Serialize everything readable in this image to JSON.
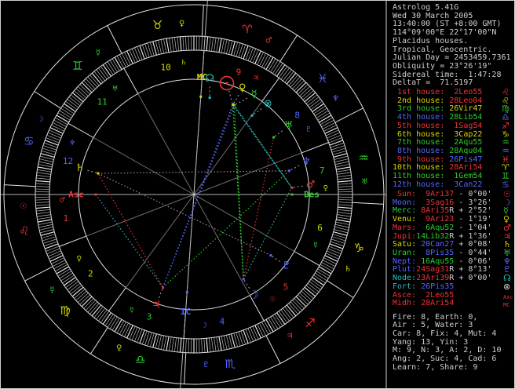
{
  "colors": {
    "red": "#ee3333",
    "yellow": "#d8d800",
    "green": "#2ecc2e",
    "blue": "#5566ff",
    "cyan": "#2abbbb",
    "white": "#cfcfcf",
    "gray": "#9a9a9a"
  },
  "header": {
    "lines": [
      "Astrolog 5.41G",
      "Wed 30 March 2005",
      "13:40:00 (ST +8:00 GMT)",
      "114°09'00\"E 22°17'00\"N",
      "Placidus houses.",
      "Tropical, Geocentric.",
      "Julian Day = 2453459.7361",
      "Obliquity = 23°26'19\"",
      "Sidereal time:  1:47:28",
      "DeltaT =  71.5197"
    ]
  },
  "houses": [
    {
      "label": " 1st house:",
      "label_color": "red",
      "value": "2Leo55",
      "value_color": "red",
      "glyph": "♌",
      "glyph_color": "red"
    },
    {
      "label": " 2nd house:",
      "label_color": "yellow",
      "value": "28Leo04",
      "value_color": "red",
      "glyph": "♌",
      "glyph_color": "yellow"
    },
    {
      "label": " 3rd house:",
      "label_color": "green",
      "value": "26Vir47",
      "value_color": "yellow",
      "glyph": "♍",
      "glyph_color": "green"
    },
    {
      "label": " 4th house:",
      "label_color": "blue",
      "value": "28Lib54",
      "value_color": "green",
      "glyph": "♎",
      "glyph_color": "blue"
    },
    {
      "label": " 5th house:",
      "label_color": "red",
      "value": "1Sag54",
      "value_color": "red",
      "glyph": "♐",
      "glyph_color": "red"
    },
    {
      "label": " 6th house:",
      "label_color": "yellow",
      "value": "3Cap22",
      "value_color": "yellow",
      "glyph": "♑",
      "glyph_color": "yellow"
    },
    {
      "label": " 7th house:",
      "label_color": "green",
      "value": "2Aqu55",
      "value_color": "green",
      "glyph": "♒",
      "glyph_color": "green"
    },
    {
      "label": " 8th house:",
      "label_color": "blue",
      "value": "28Aqu04",
      "value_color": "green",
      "glyph": "♒",
      "glyph_color": "blue"
    },
    {
      "label": " 9th house:",
      "label_color": "red",
      "value": "26Pis47",
      "value_color": "blue",
      "glyph": "♓",
      "glyph_color": "red"
    },
    {
      "label": "10th house:",
      "label_color": "yellow",
      "value": "28Ari54",
      "value_color": "red",
      "glyph": "♈",
      "glyph_color": "yellow"
    },
    {
      "label": "11th house:",
      "label_color": "green",
      "value": "1Gem54",
      "value_color": "green",
      "glyph": "♊",
      "glyph_color": "green"
    },
    {
      "label": "12th house:",
      "label_color": "blue",
      "value": "3Can22",
      "value_color": "blue",
      "glyph": "♋",
      "glyph_color": "blue"
    }
  ],
  "planets_table": [
    {
      "label": " Sun:",
      "label_color": "red",
      "value": "9Ari37",
      "retro": false,
      "value_color": "red",
      "vel": "- 0°00'",
      "glyph": "☉",
      "glyph_color": "red"
    },
    {
      "label": "Moon:",
      "label_color": "blue",
      "value": "3Sag16",
      "retro": false,
      "value_color": "red",
      "vel": "- 3°26'",
      "glyph": "☽",
      "glyph_color": "blue"
    },
    {
      "label": "Merc:",
      "label_color": "green",
      "value": "8Ari35",
      "retro": true,
      "value_color": "red",
      "vel": "+ 2°52'",
      "glyph": "☿",
      "glyph_color": "green"
    },
    {
      "label": "Venu:",
      "label_color": "yellow",
      "value": "9Ari23",
      "retro": false,
      "value_color": "red",
      "vel": "- 1°19'",
      "glyph": "♀",
      "glyph_color": "yellow"
    },
    {
      "label": "Mars:",
      "label_color": "red",
      "value": "6Aqu52",
      "retro": false,
      "value_color": "green",
      "vel": "- 1°04'",
      "glyph": "♂",
      "glyph_color": "red"
    },
    {
      "label": "Jupi:",
      "label_color": "red",
      "value": "14Lib32",
      "retro": true,
      "value_color": "green",
      "vel": "+ 1°36'",
      "glyph": "♃",
      "glyph_color": "red"
    },
    {
      "label": "Satu:",
      "label_color": "yellow",
      "value": "20Can27",
      "retro": false,
      "value_color": "blue",
      "vel": "+ 0°08'",
      "glyph": "♄",
      "glyph_color": "yellow"
    },
    {
      "label": "Uran:",
      "label_color": "green",
      "value": "8Pis35",
      "retro": false,
      "value_color": "blue",
      "vel": "- 0°44'",
      "glyph": "♅",
      "glyph_color": "green"
    },
    {
      "label": "Nept:",
      "label_color": "blue",
      "value": "16Aqu55",
      "retro": false,
      "value_color": "green",
      "vel": "- 0°06'",
      "glyph": "♆",
      "glyph_color": "blue"
    },
    {
      "label": "Plut:",
      "label_color": "blue",
      "value": "24Sag31",
      "retro": true,
      "value_color": "red",
      "vel": "+ 8°13'",
      "glyph": "♇",
      "glyph_color": "blue"
    },
    {
      "label": "Node:",
      "label_color": "cyan",
      "value": "23Ari39",
      "retro": true,
      "value_color": "red",
      "vel": "+ 0°00'",
      "glyph": "☊",
      "glyph_color": "cyan"
    },
    {
      "label": "Fort:",
      "label_color": "cyan",
      "value": "26Pis35",
      "retro": false,
      "value_color": "blue",
      "vel": "",
      "glyph": "⊗",
      "glyph_color": "white"
    },
    {
      "label": "Asce:",
      "label_color": "red",
      "value": "2Leo55",
      "retro": false,
      "value_color": "red",
      "vel": "",
      "glyph": "Asc",
      "glyph_color": "red"
    },
    {
      "label": "Midh:",
      "label_color": "red",
      "value": "28Ari54",
      "retro": false,
      "value_color": "red",
      "vel": "",
      "glyph": "MC",
      "glyph_color": "red"
    }
  ],
  "stats": [
    "Fire: 8, Earth: 0,",
    "Air : 5, Water: 3",
    "Car: 8, Fix: 4, Mut: 4",
    "Yang: 13, Yin: 3",
    "M: 9, N: 3, A: 2, D: 10",
    "Ang: 2, Suc: 4, Cad: 6",
    "Learn: 7, Share: 9"
  ],
  "wheel": {
    "asc_lambda": 122.917,
    "signs": [
      {
        "name": "aries",
        "glyph": "♈",
        "color": "red",
        "ruler": "♂",
        "ruler_color": "red"
      },
      {
        "name": "taurus",
        "glyph": "♉",
        "color": "yellow",
        "ruler": "♀",
        "ruler_color": "yellow"
      },
      {
        "name": "gemini",
        "glyph": "♊",
        "color": "green",
        "ruler": "☿",
        "ruler_color": "green"
      },
      {
        "name": "cancer",
        "glyph": "♋",
        "color": "blue",
        "ruler": "☽",
        "ruler_color": "blue"
      },
      {
        "name": "leo",
        "glyph": "♌",
        "color": "red",
        "ruler": "☉",
        "ruler_color": "red"
      },
      {
        "name": "virgo",
        "glyph": "♍",
        "color": "yellow",
        "ruler": "☿",
        "ruler_color": "green"
      },
      {
        "name": "libra",
        "glyph": "♎",
        "color": "green",
        "ruler": "♀",
        "ruler_color": "yellow"
      },
      {
        "name": "scorpio",
        "glyph": "♏",
        "color": "blue",
        "ruler": "♇",
        "ruler_color": "blue"
      },
      {
        "name": "sagittarius",
        "glyph": "♐",
        "color": "red",
        "ruler": "♃",
        "ruler_color": "red"
      },
      {
        "name": "capricorn",
        "glyph": "♑",
        "color": "yellow",
        "ruler": "♄",
        "ruler_color": "yellow"
      },
      {
        "name": "aquarius",
        "glyph": "♒",
        "color": "green",
        "ruler": "♅",
        "ruler_color": "green"
      },
      {
        "name": "pisces",
        "glyph": "♓",
        "color": "blue",
        "ruler": "♆",
        "ruler_color": "blue"
      }
    ],
    "cusps": [
      122.917,
      144.067,
      176.783,
      208.9,
      241.9,
      273.367,
      302.917,
      324.067,
      356.783,
      28.9,
      61.9,
      93.367
    ],
    "house_numbers": [
      {
        "n": "1",
        "color": "red",
        "ruler": "♂",
        "ruler_color": "red"
      },
      {
        "n": "2",
        "color": "yellow",
        "ruler": "♀",
        "ruler_color": "yellow"
      },
      {
        "n": "3",
        "color": "green",
        "ruler": "☿",
        "ruler_color": "green"
      },
      {
        "n": "4",
        "color": "blue",
        "ruler": "☽",
        "ruler_color": "blue"
      },
      {
        "n": "5",
        "color": "red",
        "ruler": "☉",
        "ruler_color": "red"
      },
      {
        "n": "6",
        "color": "yellow",
        "ruler": "☿",
        "ruler_color": "green"
      },
      {
        "n": "7",
        "color": "green",
        "ruler": "♀",
        "ruler_color": "yellow"
      },
      {
        "n": "8",
        "color": "blue",
        "ruler": "♇",
        "ruler_color": "blue"
      },
      {
        "n": "9",
        "color": "red",
        "ruler": "♃",
        "ruler_color": "red"
      },
      {
        "n": "10",
        "color": "yellow",
        "ruler": "♄",
        "ruler_color": "yellow"
      },
      {
        "n": "11",
        "color": "green",
        "ruler": "♅",
        "ruler_color": "green"
      },
      {
        "n": "12",
        "color": "blue",
        "ruler": "♆",
        "ruler_color": "blue"
      }
    ],
    "planets": [
      {
        "name": "sun",
        "glyph": "☉",
        "color": "red",
        "lambda": 9.617,
        "disp": 286.5,
        "big": true
      },
      {
        "name": "moon",
        "glyph": "☽",
        "color": "blue",
        "lambda": 243.267,
        "disp": 59.3
      },
      {
        "name": "merc",
        "glyph": "☿",
        "color": "green",
        "lambda": 8.583,
        "disp": 301.0
      },
      {
        "name": "venu",
        "glyph": "♀",
        "color": "yellow",
        "lambda": 9.383,
        "disp": 294.5
      },
      {
        "name": "mars",
        "glyph": "♂",
        "color": "red",
        "lambda": 306.867,
        "disp": 355.3
      },
      {
        "name": "jupi",
        "glyph": "♃",
        "color": "red",
        "lambda": 194.533,
        "disp": 108.8
      },
      {
        "name": "satu",
        "glyph": "♄",
        "color": "yellow",
        "lambda": 110.45,
        "disp": 192.9
      },
      {
        "name": "uran",
        "glyph": "♅",
        "color": "green",
        "lambda": 338.583,
        "disp": 324.1
      },
      {
        "name": "nept",
        "glyph": "♆",
        "color": "blue",
        "lambda": 316.917,
        "disp": 343.8
      },
      {
        "name": "plut",
        "glyph": "♇",
        "color": "blue",
        "lambda": 264.517,
        "disp": 37.7
      },
      {
        "name": "node",
        "glyph": "☊",
        "color": "cyan",
        "lambda": 23.65,
        "disp": 277.8
      },
      {
        "name": "fort",
        "glyph": "⊗",
        "color": "cyan",
        "lambda": 356.583,
        "disp": 309.3
      }
    ],
    "axes": [
      {
        "name": "asc",
        "label": "Asc",
        "color": "red",
        "alpha": 180
      },
      {
        "name": "mc",
        "label": "MC",
        "color": "yellow",
        "alpha": 274.02
      },
      {
        "name": "des",
        "label": "Des",
        "color": "green",
        "alpha": 0
      },
      {
        "name": "ic",
        "label": "IC",
        "color": "blue",
        "alpha": 94.02
      }
    ],
    "aspect_colors": {
      "trine": "#2ecc2e",
      "opposition": "#5566ff",
      "square": "#ee3333",
      "sextile": "#2abbbb",
      "quincunx": "#aa88aa"
    },
    "aspects": [
      {
        "a": "sun",
        "b": "moon",
        "type": "trine"
      },
      {
        "a": "merc",
        "b": "moon",
        "type": "trine"
      },
      {
        "a": "venu",
        "b": "moon",
        "type": "trine"
      },
      {
        "a": "jupi",
        "b": "nept",
        "type": "trine"
      },
      {
        "a": "jupi",
        "b": "sun",
        "type": "opposition"
      },
      {
        "a": "jupi",
        "b": "merc",
        "type": "opposition"
      },
      {
        "a": "jupi",
        "b": "venu",
        "type": "opposition"
      },
      {
        "a": "moon",
        "b": "uran",
        "type": "square"
      },
      {
        "a": "jupi",
        "b": "satu",
        "type": "square"
      },
      {
        "a": "moon",
        "b": "mars",
        "type": "sextile"
      },
      {
        "a": "sun",
        "b": "mars",
        "type": "sextile"
      },
      {
        "a": "merc",
        "b": "mars",
        "type": "sextile"
      },
      {
        "a": "venu",
        "b": "mars",
        "type": "sextile"
      },
      {
        "a": "asc",
        "b": "jupi",
        "type": "sextile"
      },
      {
        "a": "satu",
        "b": "nept",
        "type": "quincunx"
      },
      {
        "a": "satu",
        "b": "plut",
        "type": "quincunx"
      }
    ]
  }
}
